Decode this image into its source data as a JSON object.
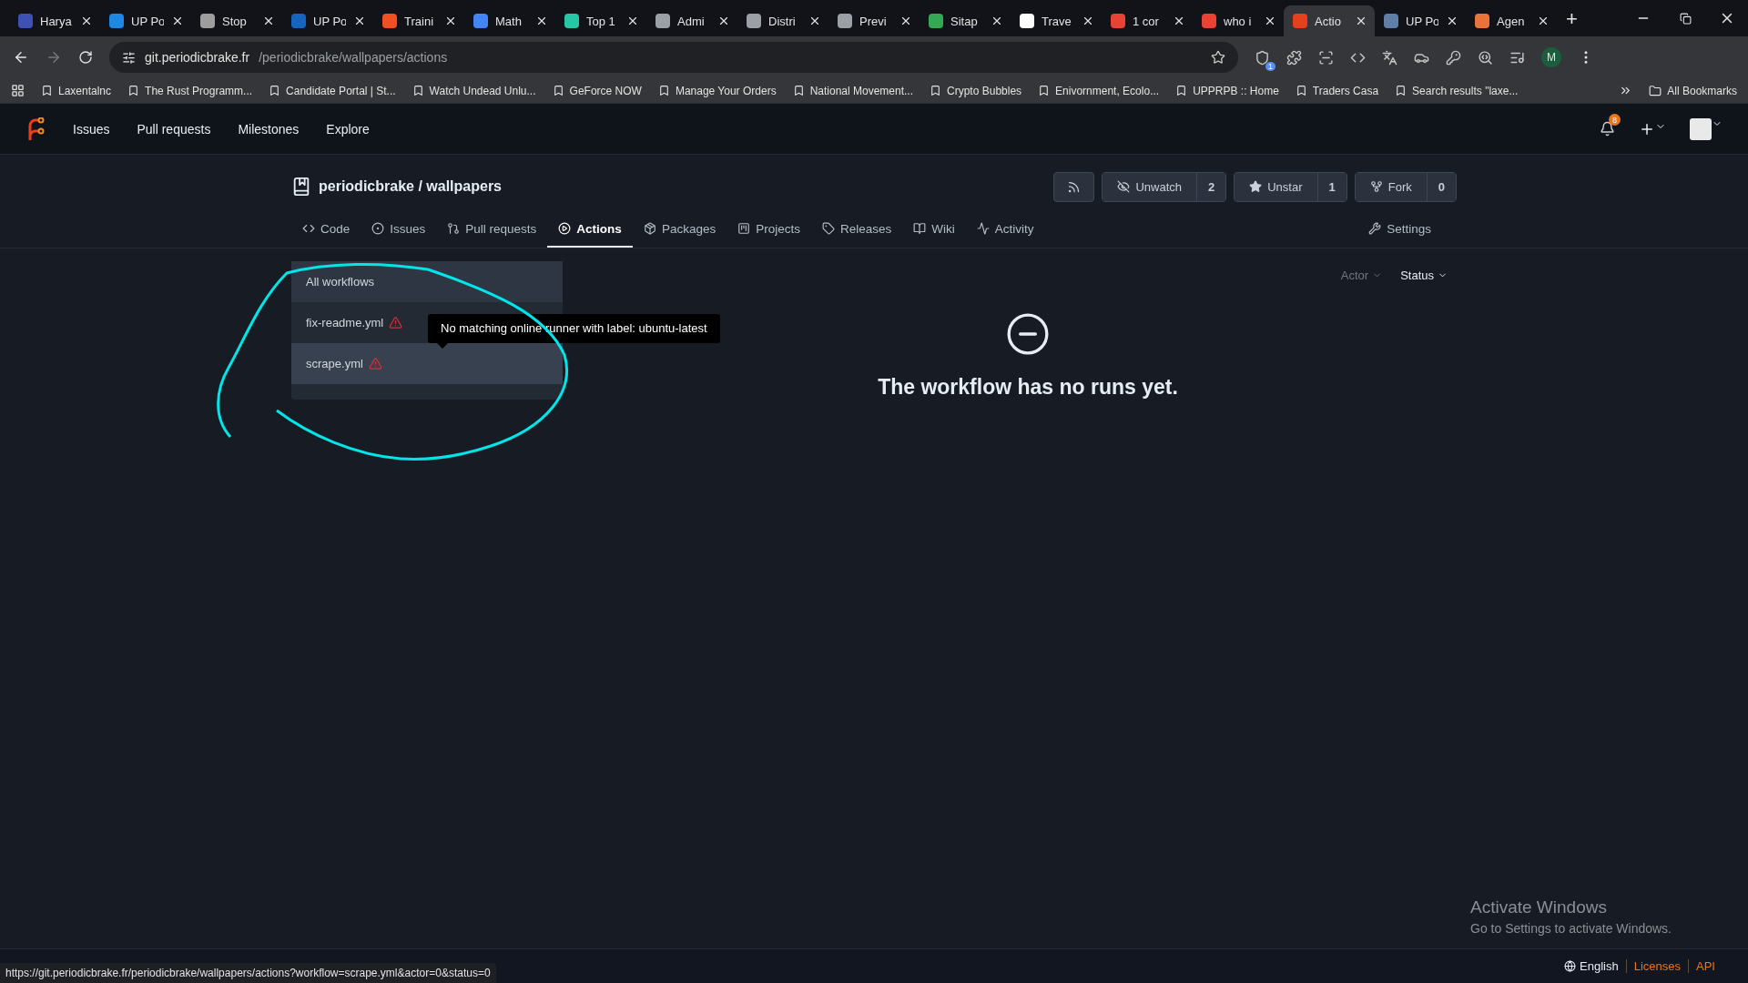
{
  "browser": {
    "tabs": [
      {
        "title": "Harya",
        "selected": false,
        "color": "#3f51b5"
      },
      {
        "title": "UP Po",
        "selected": false,
        "color": "#1e88e5"
      },
      {
        "title": "Stop",
        "selected": false,
        "color": "#9e9e9e"
      },
      {
        "title": "UP Po",
        "selected": false,
        "color": "#1565c0"
      },
      {
        "title": "Traini",
        "selected": false,
        "color": "#f25022"
      },
      {
        "title": "Math",
        "selected": false,
        "color": "#4285f4"
      },
      {
        "title": "Top 1",
        "selected": false,
        "color": "#26c6a6"
      },
      {
        "title": "Admi",
        "selected": false,
        "color": "#9aa0a6"
      },
      {
        "title": "Distri",
        "selected": false,
        "color": "#9aa0a6"
      },
      {
        "title": "Previ",
        "selected": false,
        "color": "#9aa0a6"
      },
      {
        "title": "Sitap",
        "selected": false,
        "color": "#34a853"
      },
      {
        "title": "Trave",
        "selected": false,
        "color": "#ffffff"
      },
      {
        "title": "1 cor",
        "selected": false,
        "color": "#ea4335"
      },
      {
        "title": "who i",
        "selected": false,
        "color": "#ea4335"
      },
      {
        "title": "Actio",
        "selected": true,
        "color": "#e8401c"
      },
      {
        "title": "UP Po",
        "selected": false,
        "color": "#5f7fa8"
      },
      {
        "title": "Agen",
        "selected": false,
        "color": "#e8743c"
      }
    ],
    "new_tab": "+",
    "address": {
      "host": "git.periodicbrake.fr",
      "path": "/periodicbrake/wallpapers/actions"
    },
    "extension_badge": "1",
    "profile_initial": "M",
    "bookmarks": [
      "Laxentalnc",
      "The Rust Programm...",
      "Candidate Portal | St...",
      "Watch Undead Unlu...",
      "GeForce NOW",
      "Manage Your Orders",
      "National Movement...",
      "Crypto Bubbles",
      "Enivornment, Ecolo...",
      "UPPRPB :: Home",
      "Traders Casa",
      "Search results \"laxe..."
    ],
    "all_bookmarks": "All Bookmarks",
    "status_url": "https://git.periodicbrake.fr/periodicbrake/wallpapers/actions?workflow=scrape.yml&actor=0&status=0"
  },
  "nav": {
    "links": [
      "Issues",
      "Pull requests",
      "Milestones",
      "Explore"
    ],
    "notification_count": "8"
  },
  "repo": {
    "owner": "periodicbrake",
    "separator": "/",
    "name": "wallpapers",
    "buttons": [
      {
        "label": "Unwatch",
        "count": "2",
        "kind": "watch"
      },
      {
        "label": "Unstar",
        "count": "1",
        "kind": "star"
      },
      {
        "label": "Fork",
        "count": "0",
        "kind": "fork"
      }
    ],
    "tabs": [
      {
        "label": "Code",
        "kind": "code",
        "selected": false
      },
      {
        "label": "Issues",
        "kind": "issues",
        "selected": false
      },
      {
        "label": "Pull requests",
        "kind": "pulls",
        "selected": false
      },
      {
        "label": "Actions",
        "kind": "actions",
        "selected": true
      },
      {
        "label": "Packages",
        "kind": "packages",
        "selected": false
      },
      {
        "label": "Projects",
        "kind": "projects",
        "selected": false
      },
      {
        "label": "Releases",
        "kind": "releases",
        "selected": false
      },
      {
        "label": "Wiki",
        "kind": "wiki",
        "selected": false
      },
      {
        "label": "Activity",
        "kind": "activity",
        "selected": false
      }
    ],
    "settings": "Settings"
  },
  "workflows": [
    {
      "label": "All workflows",
      "selected": true,
      "hovered": false,
      "warning": false
    },
    {
      "label": "fix-readme.yml",
      "selected": false,
      "hovered": false,
      "warning": true
    },
    {
      "label": "scrape.yml",
      "selected": false,
      "hovered": true,
      "warning": true
    }
  ],
  "tooltip": "No matching online runner with label: ubuntu-latest",
  "filters": [
    {
      "label": "Actor",
      "disabled": true
    },
    {
      "label": "Status",
      "disabled": false
    }
  ],
  "empty_state": "The workflow has no runs yet.",
  "footer": {
    "language": "English",
    "links": [
      "Licenses",
      "API"
    ]
  },
  "os_notice": {
    "title": "Activate Windows",
    "text": "Go to Settings to activate Windows."
  }
}
